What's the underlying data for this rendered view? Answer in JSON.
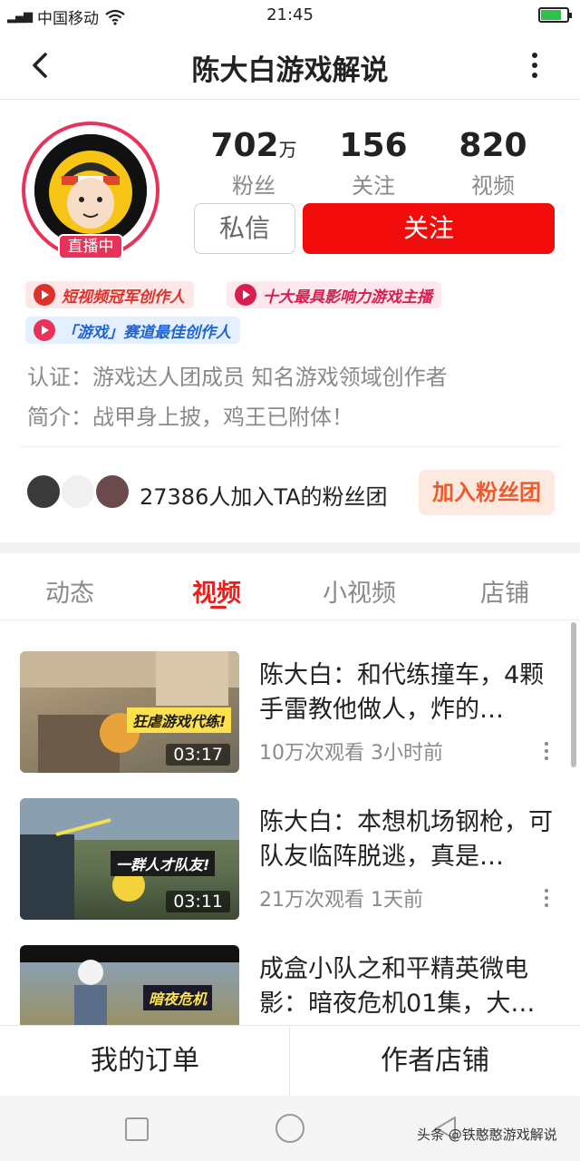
{
  "status_bar": {
    "carrier": "中国移动",
    "time": "21:45"
  },
  "header": {
    "title": "陈大白游戏解说"
  },
  "profile": {
    "live_badge": "直播中",
    "stats": [
      {
        "value": "702",
        "unit": "万",
        "label": "粉丝"
      },
      {
        "value": "156",
        "unit": "",
        "label": "关注"
      },
      {
        "value": "820",
        "unit": "",
        "label": "视频"
      }
    ],
    "message_button": "私信",
    "follow_button": "关注",
    "badges": [
      "短视频冠军创作人",
      "十大最具影响力游戏主播",
      "「游戏」赛道最佳创作人"
    ],
    "certification": "认证：游戏达人团成员 知名游戏领域创作者",
    "intro": "简介：战甲身上披，鸡王已附体！",
    "fan_club_text": "27386人加入TA的粉丝团",
    "fan_club_button": "加入粉丝团"
  },
  "tabs": [
    {
      "label": "动态"
    },
    {
      "label": "视频",
      "active": true
    },
    {
      "label": "小视频"
    },
    {
      "label": "店铺"
    }
  ],
  "videos": [
    {
      "title": "陈大白：和代练撞车，4颗手雷教他做人，炸的…",
      "views": "10万次观看",
      "time": "3小时前",
      "duration": "03:17",
      "thumb_caption": "狂虐游戏代练!"
    },
    {
      "title": "陈大白：本想机场钢枪，可队友临阵脱逃，真是…",
      "views": "21万次观看",
      "time": "1天前",
      "duration": "03:11",
      "thumb_caption": "一群人才队友!"
    },
    {
      "title": "成盒小队之和平精英微电影：暗夜危机01集，大…",
      "views": "",
      "time": "",
      "duration": "",
      "thumb_caption": "暗夜危机"
    }
  ],
  "bottom_bar": {
    "orders": "我的订单",
    "shop": "作者店铺"
  },
  "watermark": "头条 @铁憨憨游戏解说",
  "colors": {
    "accent": "#f20c0c",
    "tab_active": "#e8211f",
    "live_badge": "#e8325a",
    "join": "#f05a28"
  }
}
